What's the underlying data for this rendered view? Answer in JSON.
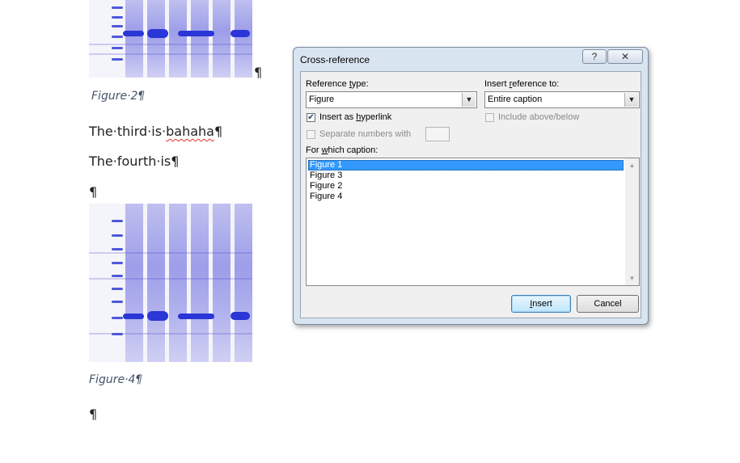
{
  "document": {
    "caption_top": "Figure·2¶",
    "para1_prefix": "The·third·is·",
    "para1_misspelled": "bahaha",
    "para1_mark": "¶",
    "para2": "The·fourth·is¶",
    "empty_para": "¶",
    "image_mark": "¶",
    "caption_bottom": "Figure·4¶",
    "trailing_para": "¶"
  },
  "dialog": {
    "title": "Cross-reference",
    "help_icon": "?",
    "close_icon": "✕",
    "reference_type": {
      "label_pre": "Reference ",
      "label_key": "t",
      "label_post": "ype:",
      "value": "Figure"
    },
    "insert_reference_to": {
      "label_pre": "Insert ",
      "label_key": "r",
      "label_post": "eference to:",
      "value": "Entire caption"
    },
    "insert_hyperlink": {
      "label_pre": "Insert as ",
      "label_key": "h",
      "label_post": "yperlink",
      "checked": true
    },
    "include_above_below": {
      "label": "Include above/below",
      "checked": false,
      "enabled": false
    },
    "separate_numbers": {
      "label": "Separate numbers with",
      "checked": false,
      "enabled": false,
      "value": ""
    },
    "for_which_caption": {
      "label_pre": "For ",
      "label_key": "w",
      "label_post": "hich caption:"
    },
    "captions": [
      "Figure 1",
      "Figure 3",
      "Figure 2",
      "Figure 4"
    ],
    "selected_caption_index": 0,
    "insert_button": {
      "label_key": "I",
      "label_post": "nsert"
    },
    "cancel_button": "Cancel"
  },
  "colors": {
    "selection": "#3399ff",
    "caption_text": "#44546a",
    "dialog_frame": "#d9e4f1"
  }
}
